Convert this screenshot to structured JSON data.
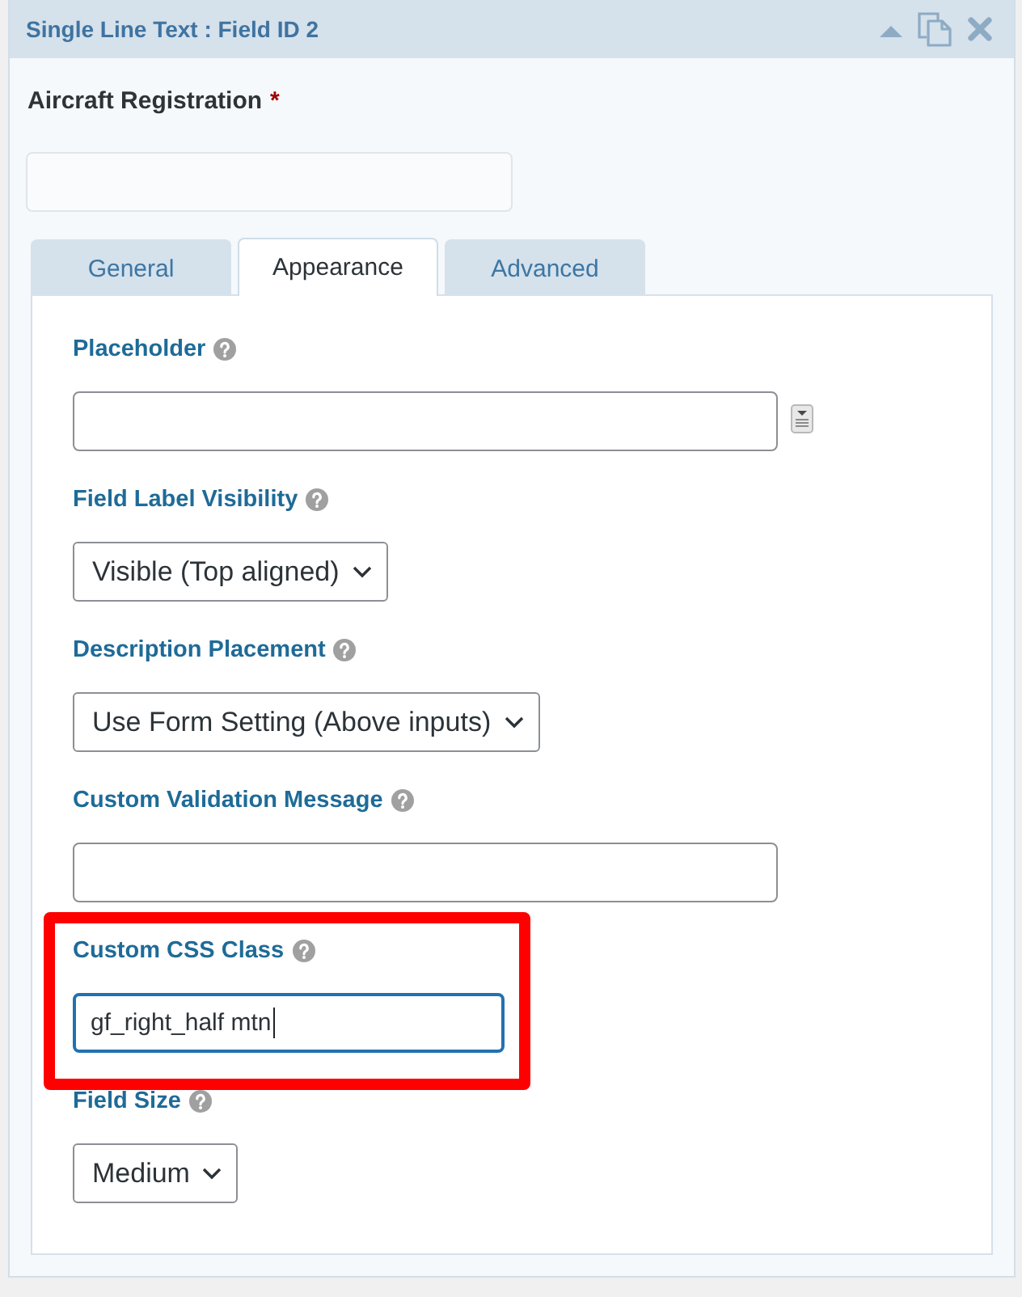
{
  "panel": {
    "title": "Single Line Text : Field ID 2"
  },
  "field_preview": {
    "label": "Aircraft Registration",
    "required_mark": "*"
  },
  "tabs": [
    {
      "label": "General",
      "selected": false
    },
    {
      "label": "Appearance",
      "selected": true
    },
    {
      "label": "Advanced",
      "selected": false
    }
  ],
  "settings": [
    {
      "kind": "text",
      "label": "Placeholder",
      "merge_tags": true,
      "focused": false,
      "highlighted": false
    },
    {
      "kind": "select",
      "label": "Field Label Visibility",
      "value": "Visible (Top aligned)",
      "highlighted": false
    },
    {
      "kind": "select",
      "label": "Description Placement",
      "value": "Use Form Setting (Above inputs)",
      "highlighted": false
    },
    {
      "kind": "text",
      "label": "Custom Validation Message",
      "focused": false,
      "highlighted": false
    },
    {
      "kind": "text",
      "label": "Custom CSS Class",
      "value": "gf_right_half mtn",
      "focused": true,
      "highlighted": true
    },
    {
      "kind": "select",
      "label": "Field Size",
      "value": "Medium",
      "highlighted": false
    }
  ]
}
